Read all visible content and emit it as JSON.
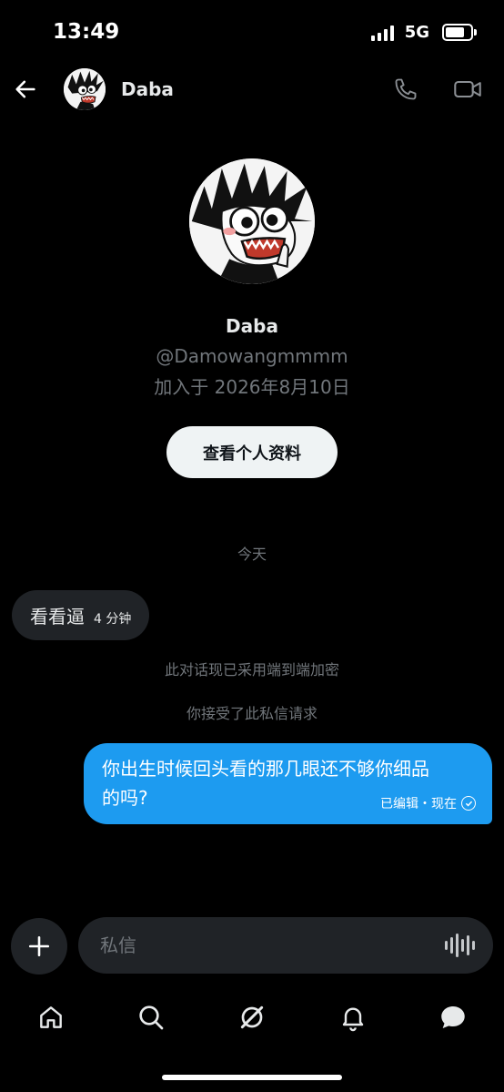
{
  "status_bar": {
    "time": "13:49",
    "network": "5G"
  },
  "header": {
    "name": "Daba"
  },
  "profile": {
    "name": "Daba",
    "handle": "@Damowangmmmm",
    "joined": "加入于 2026年8月10日",
    "view_profile_label": "查看个人资料"
  },
  "conversation": {
    "date_divider": "今天",
    "incoming": {
      "text": "看看逼",
      "time": "4 分钟"
    },
    "system_messages": [
      "此对话现已采用端到端加密",
      "你接受了此私信请求"
    ],
    "outgoing": {
      "line1": "你出生时候回头看的那几眼还不够你细品",
      "line2": "的吗?",
      "meta": "已编辑・现在"
    }
  },
  "composer": {
    "placeholder": "私信"
  },
  "tab_bar": {
    "items": [
      {
        "icon": "home-icon"
      },
      {
        "icon": "search-icon"
      },
      {
        "icon": "grok-icon"
      },
      {
        "icon": "bell-icon"
      },
      {
        "icon": "messages-icon"
      }
    ]
  },
  "colors": {
    "background": "#000000",
    "accent": "#1d9bf0",
    "bubble_incoming": "#202327",
    "secondary_text": "#71767b",
    "button_light": "#eff3f4"
  }
}
